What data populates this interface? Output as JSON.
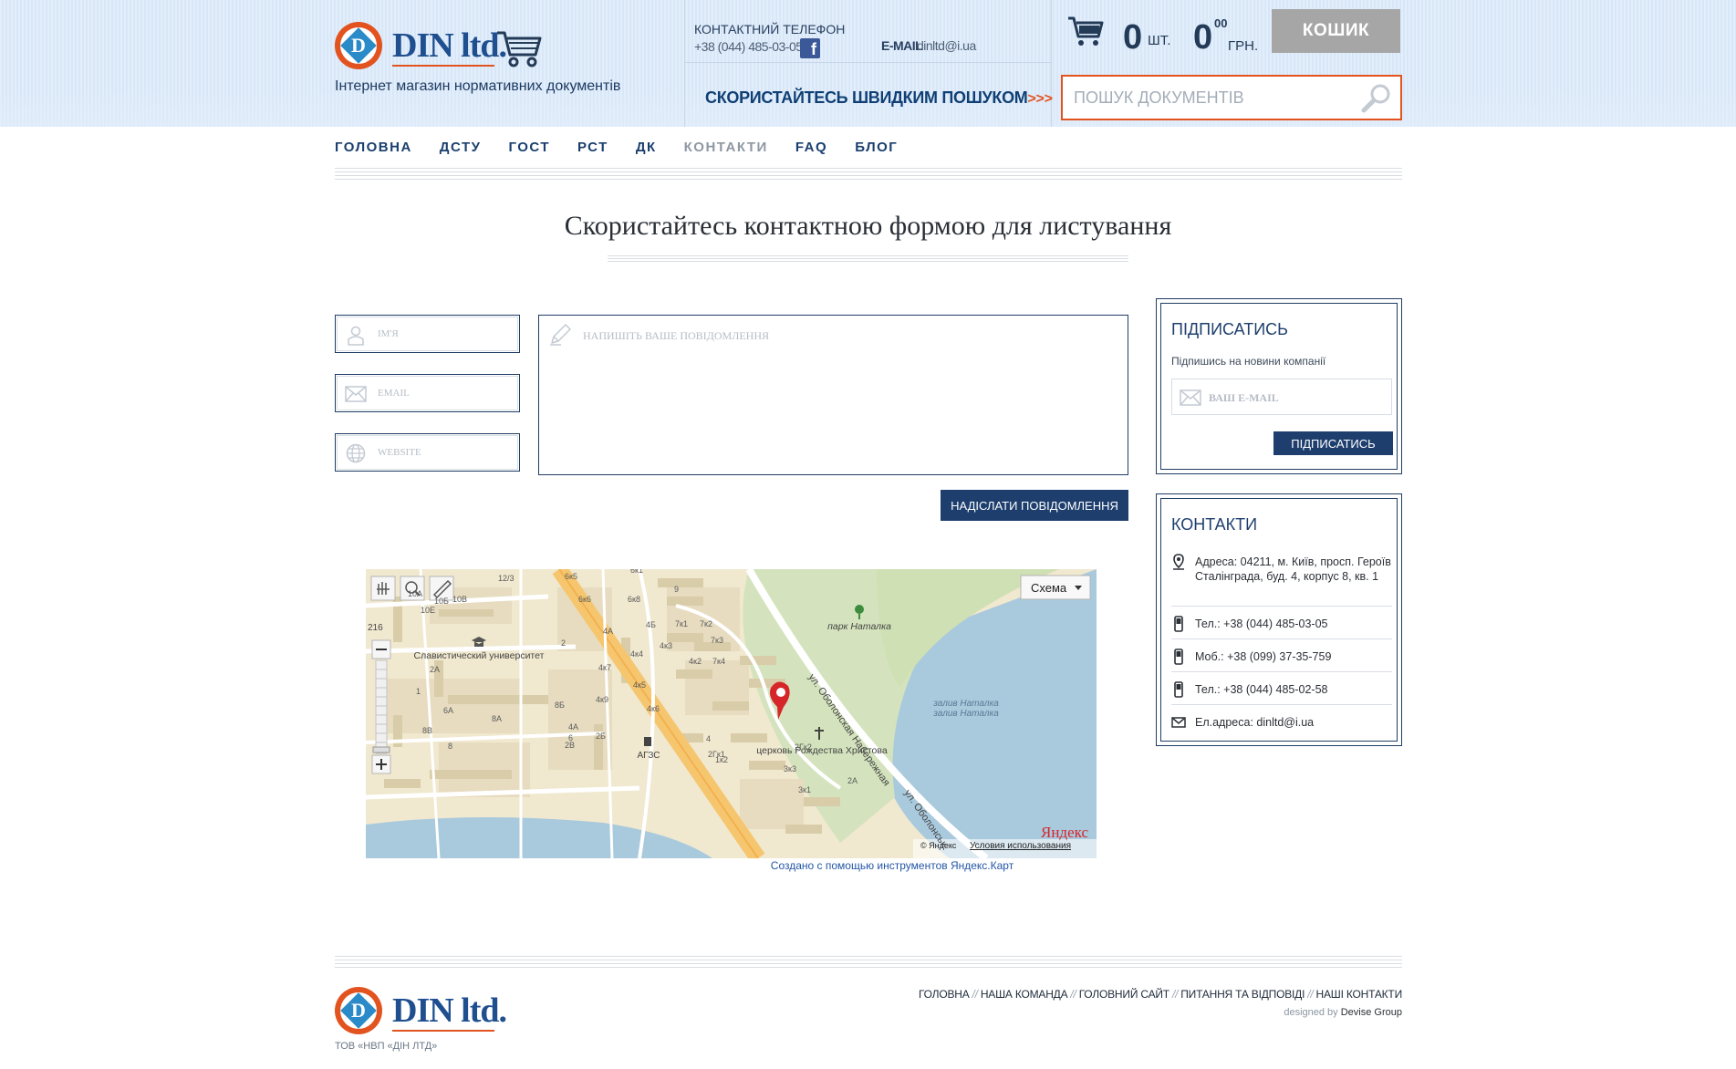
{
  "header": {
    "brand": "DIN ltd.",
    "logo_letter": "D",
    "tagline": "Інтернет магазин нормативних документів",
    "phone_label": "КОНТАКТНИЙ ТЕЛЕФОН",
    "phone_number": "+38 (044) 485-03-05",
    "facebook_letter": "f",
    "email_label": "E-MAIL",
    "email_value": "dinltd@i.ua",
    "quick_search": "СКОРИСТАЙТЕСЬ ШВИДКИМ ПОШУКОМ",
    "quick_search_arrows": ">>>",
    "cart": {
      "count": "0",
      "count_unit": "ШТ.",
      "price": "0",
      "price_kop": "00",
      "currency": "ГРН.",
      "button_label": "КОШИК"
    },
    "search": {
      "placeholder": "ПОШУК ДОКУМЕНТІВ"
    }
  },
  "nav": {
    "items": [
      {
        "label": "ГОЛОВНА",
        "active": false
      },
      {
        "label": "ДСТУ",
        "active": false
      },
      {
        "label": "ГОСТ",
        "active": false
      },
      {
        "label": "РСТ",
        "active": false
      },
      {
        "label": "ДК",
        "active": false
      },
      {
        "label": "КОНТАКТИ",
        "active": true
      },
      {
        "label": "FAQ",
        "active": false
      },
      {
        "label": "БЛОГ",
        "active": false
      }
    ]
  },
  "main": {
    "title": "Скористайтесь контактною формою для листування",
    "form": {
      "name_placeholder": "ІМ'Я",
      "email_placeholder": "EMAIL",
      "website_placeholder": "WEBSITE",
      "message_placeholder": "НАПИШІТЬ ВАШЕ ПОВІДОМЛЕННЯ",
      "send_label": "НАДІСЛАТИ ПОВІДОМЛЕННЯ"
    }
  },
  "subscribe": {
    "title": "ПІДПИСАТИСЬ",
    "description": "Підпишись на новини компанії",
    "email_placeholder": "ВАШ E-MAIL",
    "button_label": "ПІДПИСАТИСЬ"
  },
  "contacts": {
    "title": "КОНТАКТИ",
    "address": "Адреса: 04211, м. Київ, просп. Героїв Сталінграда, буд. 4, корпус 8, кв. 1",
    "phone1": "Тел.: +38 (044) 485-03-05",
    "mobile": "Моб.: +38 (099) 37-35-759",
    "phone2": "Тел.: +38 (044) 485-02-58",
    "email": "Ел.адреса: dinltd@i.ua"
  },
  "map": {
    "scheme_label": "Схема",
    "zoom_value": "216",
    "labels": {
      "university": "Славистический университет",
      "park": "парк Наталка",
      "bay1": "залив Наталка",
      "bay2": "залив Наталка",
      "church": "церковь Рождества Христова",
      "gas": "АГЗС",
      "street": "ул. Оболонская Набережная",
      "street2": "ул. Оболонськ",
      "copyright": "© Яндекс",
      "terms": "Условия использования",
      "yandex": "Яндекс"
    },
    "house_numbers": [
      "12/3",
      "6к5",
      "6к1",
      "9",
      "10А",
      "10В",
      "10Е",
      "6к6",
      "6к8",
      "4А",
      "4Б",
      "7к1",
      "7к2",
      "7к3",
      "4к3",
      "4к4",
      "4к2",
      "7к4",
      "4к5",
      "4к6",
      "4к7",
      "4к9",
      "2",
      "2А",
      "1",
      "6А",
      "8Б",
      "8А",
      "4А",
      "6",
      "10Б",
      "8В",
      "8",
      "2Б",
      "2В",
      "4",
      "2Гк1",
      "2Гк2",
      "3к3",
      "3к1",
      "2А",
      "1к2"
    ],
    "credit": "Создано с помощью инструментов Яндекс.Карт"
  },
  "footer": {
    "links": [
      "ГОЛОВНА",
      "НАША КОМАНДА",
      "ГОЛОВНИЙ САЙТ",
      "ПИТАННЯ ТА ВІДПОВІДІ",
      "НАШІ КОНТАКТИ"
    ],
    "link_separator": "//",
    "designed_by": "designed by",
    "studio": "Devise Group",
    "company": "ТОВ «НВП «ДІН ЛТД»"
  },
  "colors": {
    "brand_blue": "#1e3f6e",
    "accent_orange": "#e2531f",
    "cart_button": "#a6a6a6"
  }
}
